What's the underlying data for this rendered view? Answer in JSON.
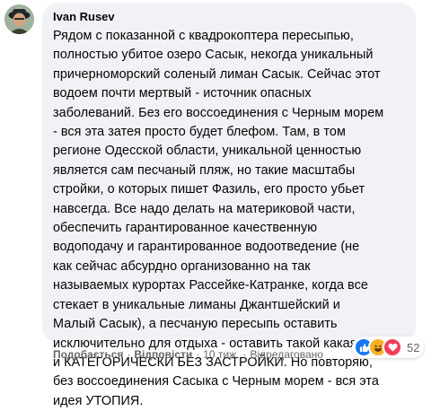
{
  "comment": {
    "author": "Ivan Rusev",
    "lines": [
      "Рядом с показанной с квадрокоптера пересыпью,",
      "полностью убитое озеро Сасык, некогда уникальный",
      "причерноморский соленый лиман Сасык. Сейчас этот",
      "водоем почти мертвый - источник опасных",
      "заболеваний. Без его воссоединения с Черным морем",
      "- вся эта затея просто будет блефом. Там, в том",
      "регионе Одесской области, уникальной ценностью",
      "является сам песчаный пляж, но такие масштабы",
      "стройки, о которых пишет Фазиль, его просто убьет",
      "навсегда. Все надо делать на материковой части,",
      "обеспечить гарантированное качественную",
      "водоподачу и гарантированное водоотведение (не",
      "как сейчас абсурдно организованно на так",
      "называемых курортах Рассейке-Катранке, когда все",
      "стекает в уникальные лиманы Джантшейский и",
      "Малый Сасык), а песчаную пересыпь оставить",
      "исключительно для отдыха - оставить такой какая есть",
      "и КАТЕГОРИЧЕСКИ БЕЗ ЗАСТРОЙКИ. Но повторяю,",
      "без воссоединения Сасыка с Черным морем - вся эта",
      "идея УТОПИЯ."
    ],
    "reactions": {
      "count": "52",
      "icons": [
        "like-icon",
        "haha-icon",
        "love-icon"
      ],
      "colors": {
        "like": "#1877f2",
        "haha": "#f7b125",
        "love": "#f33e58"
      }
    }
  },
  "actions": {
    "like": "Подобається",
    "reply": "Відповісти",
    "separator": "·",
    "time": "10 тиж.",
    "edited": "Відредаговано"
  }
}
